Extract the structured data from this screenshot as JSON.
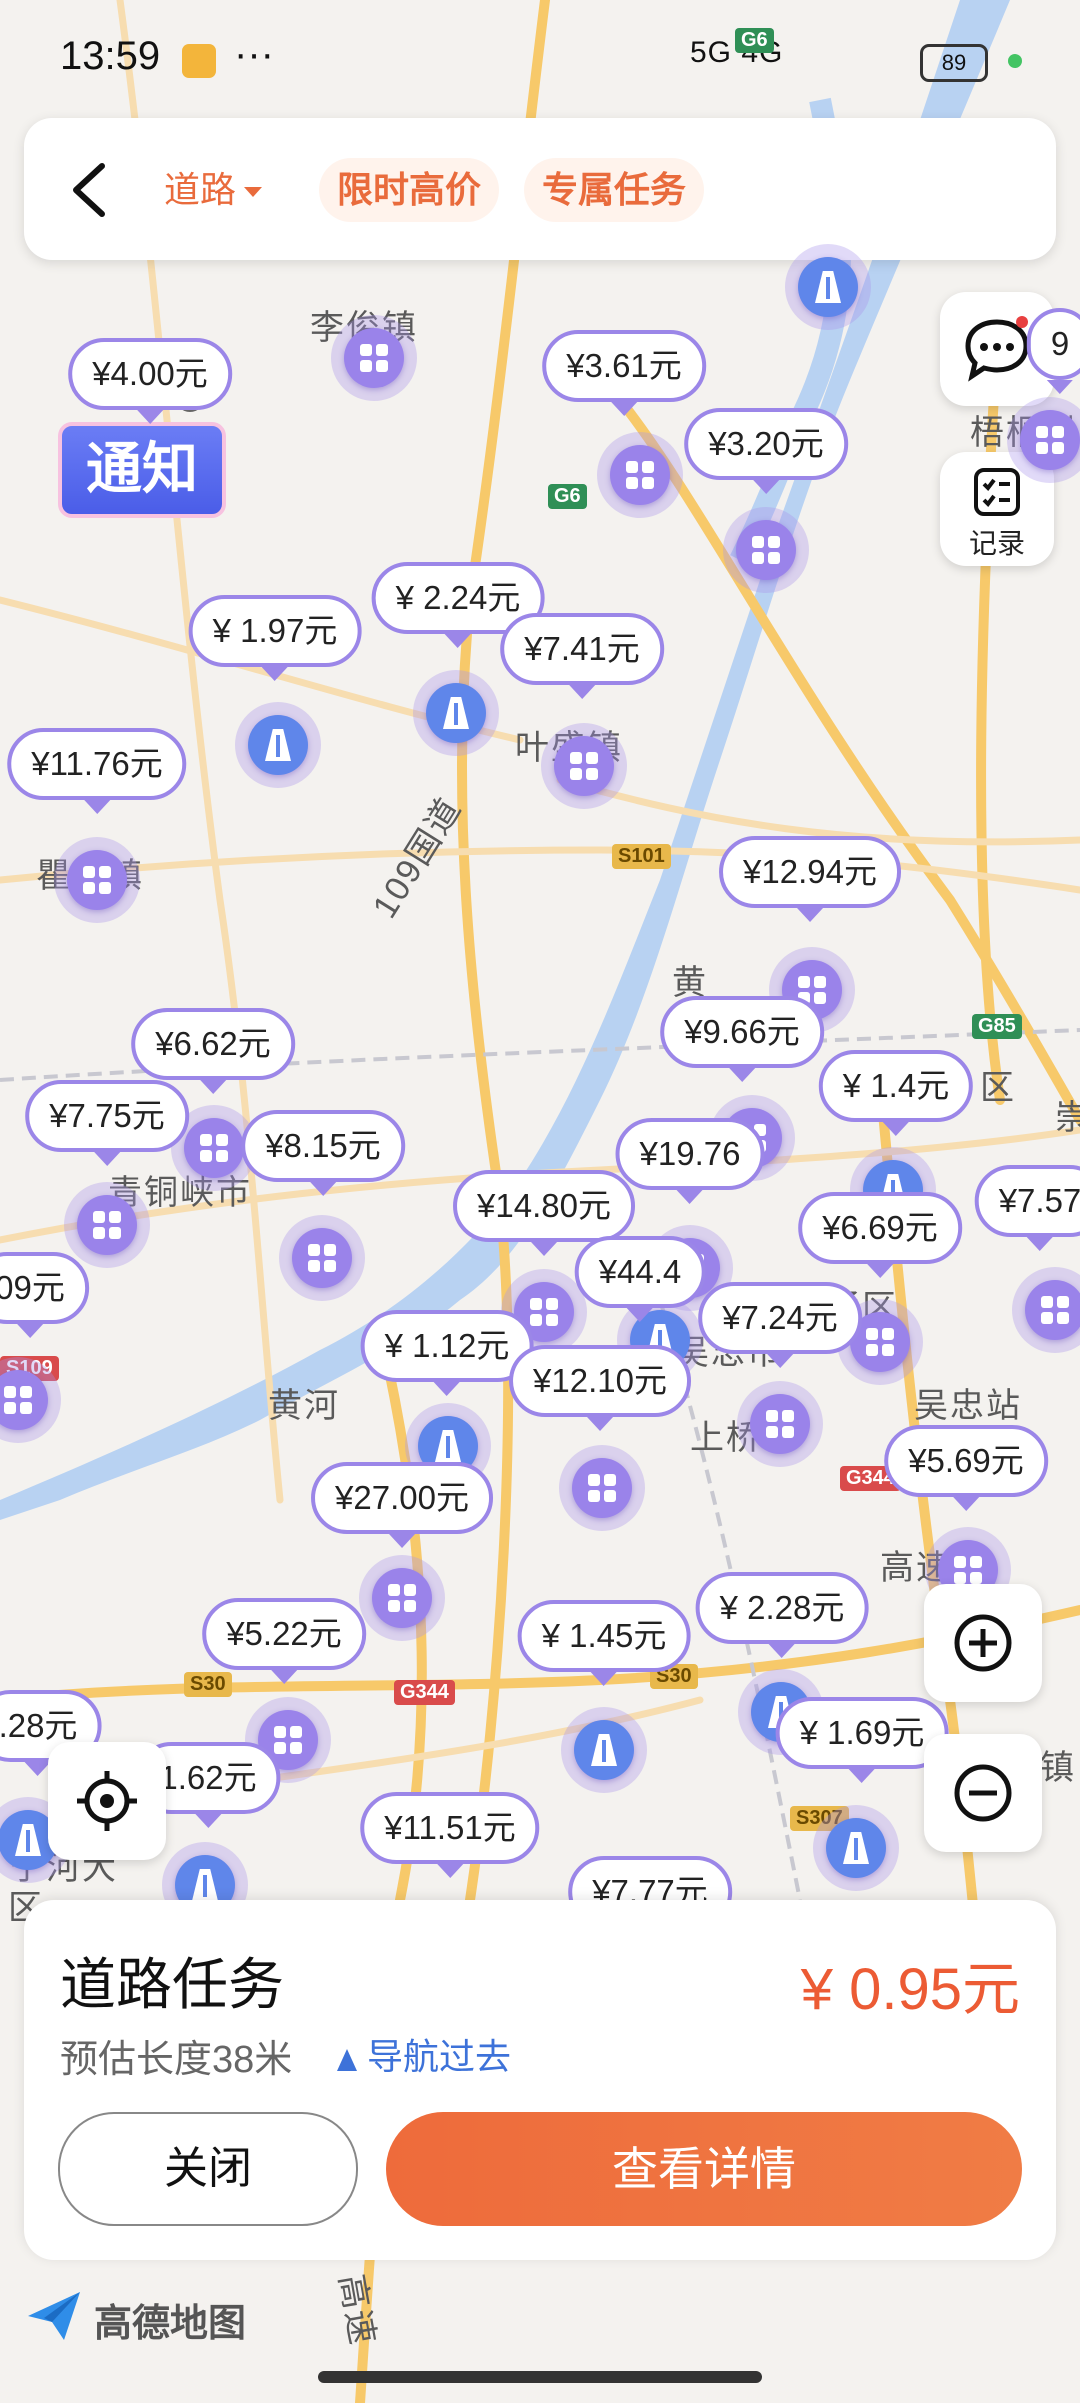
{
  "status_bar": {
    "time": "13:59",
    "more": "···",
    "network": "5G 4G",
    "battery": "89"
  },
  "top_bar": {
    "tab_road": "道路",
    "tab_limited": "限时高价",
    "tab_exclusive": "专属任务"
  },
  "side_buttons": {
    "records_label": "记录"
  },
  "notice": {
    "text": "通知",
    "close": "×"
  },
  "map_labels": [
    "李俊镇",
    "叶盛镇",
    "瞿靖镇",
    "青铜峡市",
    "黄河",
    "吴忠站",
    "上桥",
    "梧桐树",
    "崇",
    "高速",
    "镇",
    "区",
    "109国道",
    "黄",
    "宁河大",
    "区",
    "高速",
    "吴忠市",
    "利通区"
  ],
  "road_shields": [
    "G6",
    "G6",
    "S101",
    "G85",
    "S30",
    "G344",
    "S30",
    "S307",
    "G344",
    "S109"
  ],
  "price_bubbles": [
    "¥4.00元",
    "¥3.61元",
    "¥3.20元",
    "¥ 2.24元",
    "¥ 1.97元",
    "¥7.41元",
    "¥11.76元",
    "¥12.94元",
    "¥9.66元",
    "¥6.62元",
    "¥ 1.4元",
    "¥7.75元",
    "¥8.15元",
    "¥19.76",
    "¥7.57",
    "¥14.80元",
    "¥6.69元",
    "¥44.4",
    "09元",
    "¥7.24元",
    "¥ 1.12元",
    "¥12.10元",
    "¥5.69元",
    "¥27.00元",
    "¥ 2.28元",
    "¥5.22元",
    "¥ 1.45元",
    ".28元",
    "¥ 1.69元",
    "1.62元",
    "¥11.51元",
    "¥7.77元",
    "9"
  ],
  "bottom_sheet": {
    "title": "道路任务",
    "price": "¥ 0.95元",
    "length": "预估长度38米",
    "navigate": "导航过去",
    "close_button": "关闭",
    "detail_button": "查看详情"
  },
  "brand": {
    "name": "高德地图"
  },
  "colors": {
    "accent": "#ee6b3b",
    "bubble_border": "#9b86e8",
    "task_pin": "#9a83ea",
    "road_pin": "#5f86ea",
    "link": "#3d72d9"
  }
}
